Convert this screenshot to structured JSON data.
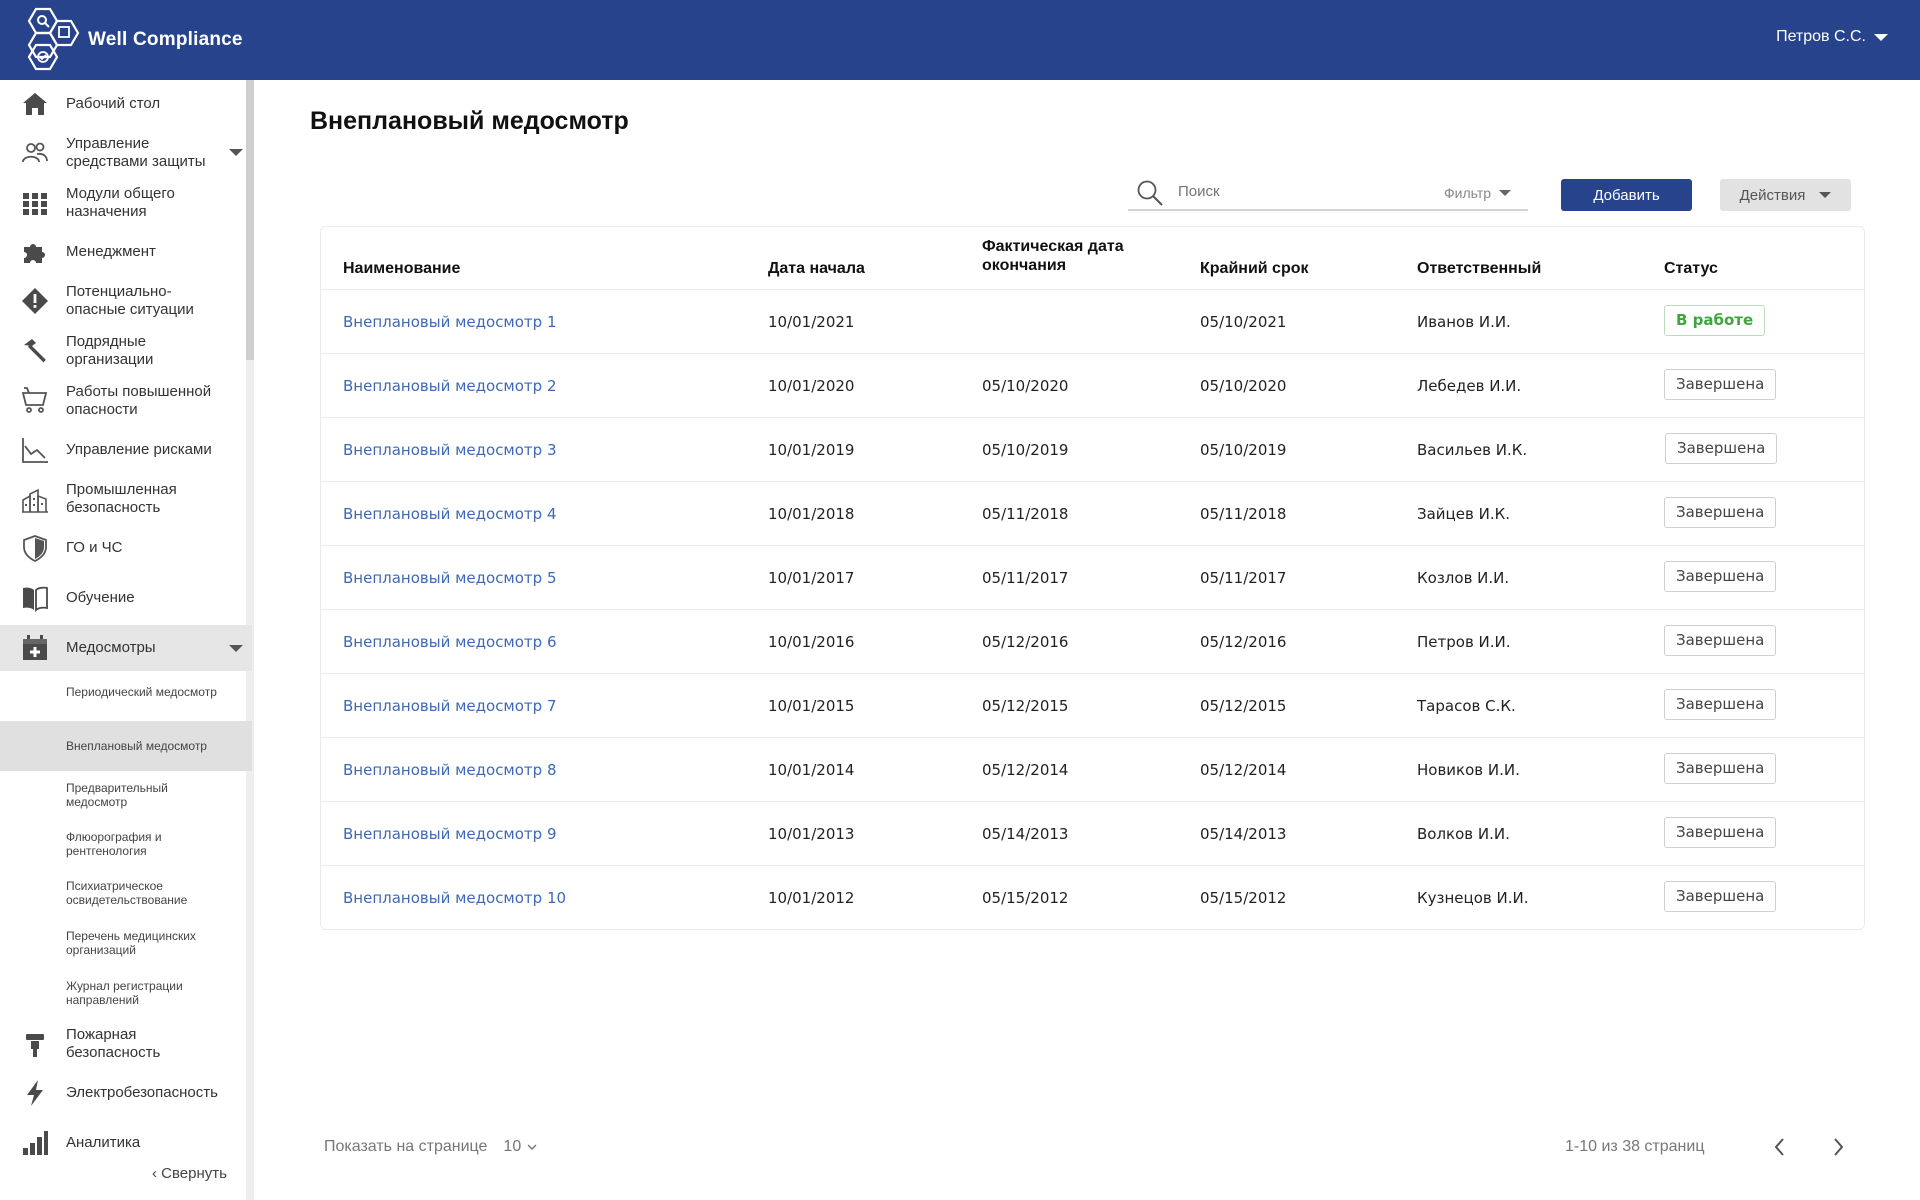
{
  "app": {
    "name": "Well Compliance",
    "user": "Петров С.С."
  },
  "colors": {
    "brand": "#27438c",
    "link": "#3e69b4",
    "status_active": "#3fa53f"
  },
  "sidebar": {
    "items": [
      {
        "label": "Рабочий стол",
        "icon": "home-icon"
      },
      {
        "label": "Управление средствами защиты",
        "icon": "users-icon"
      },
      {
        "label": "Модули общего назначения",
        "icon": "grid-icon"
      },
      {
        "label": "Менеджмент",
        "icon": "puzzle-icon"
      },
      {
        "label": "Потенциально-опасные ситуации",
        "icon": "warning-icon"
      },
      {
        "label": "Подрядные организации",
        "icon": "hammer-icon"
      },
      {
        "label": "Работы повышенной опасности",
        "icon": "cart-icon"
      },
      {
        "label": "Управление рисками",
        "icon": "chart-line-icon"
      },
      {
        "label": "Промышленная безопасность",
        "icon": "factory-icon"
      },
      {
        "label": "ГО и ЧС",
        "icon": "shield-icon"
      },
      {
        "label": "Обучение",
        "icon": "book-icon"
      },
      {
        "label": "Медосмотры",
        "icon": "medical-calendar-icon"
      },
      {
        "label": "Пожарная безопасность",
        "icon": "fire-extinguisher-icon"
      },
      {
        "label": "Электробезопасность",
        "icon": "lightning-icon"
      },
      {
        "label": "Аналитика",
        "icon": "bar-chart-icon"
      }
    ],
    "subitems": [
      {
        "label": "Периодический медосмотр"
      },
      {
        "label": "Внеплановый медосмотр"
      },
      {
        "label": "Предварительный медосмотр"
      },
      {
        "label": "Флюорография и рентгенология"
      },
      {
        "label": "Психиатрическое освидетельствование"
      },
      {
        "label": "Перечень медицинских организаций"
      },
      {
        "label": "Журнал регистрации направлений"
      }
    ],
    "collapse_label": "‹ Свернуть"
  },
  "page": {
    "title": "Внеплановый медосмотр"
  },
  "toolbar": {
    "search_placeholder": "Поиск",
    "filter_label": "Фильтр",
    "add_label": "Добавить",
    "actions_label": "Действия"
  },
  "table": {
    "columns": [
      "Наименование",
      "Дата начала",
      "Фактическая дата окончания",
      "Крайний срок",
      "Ответственный",
      "Статус"
    ],
    "rows": [
      {
        "name": "Внеплановый медосмотр 1",
        "start": "10/01/2021",
        "actual_end": "",
        "deadline": "05/10/2021",
        "responsible": "Иванов И.И.",
        "status": "В работе",
        "active": true
      },
      {
        "name": "Внеплановый  медосмотр 2",
        "start": "10/01/2020",
        "actual_end": "05/10/2020",
        "deadline": "05/10/2020",
        "responsible": "Лебедев И.И.",
        "status": "Завершена",
        "active": false
      },
      {
        "name": "Внеплановый  медосмотр 3",
        "start": "10/01/2019",
        "actual_end": "05/10/2019",
        "deadline": "05/10/2019",
        "responsible": "Васильев И.К.",
        "status": "Завершена",
        "active": false
      },
      {
        "name": "Внеплановый  медосмотр 4",
        "start": "10/01/2018",
        "actual_end": "05/11/2018",
        "deadline": "05/11/2018",
        "responsible": "Зайцев И.К.",
        "status": "Завершена",
        "active": false
      },
      {
        "name": "Внеплановый  медосмотр 5",
        "start": "10/01/2017",
        "actual_end": "05/11/2017",
        "deadline": "05/11/2017",
        "responsible": "Козлов И.И.",
        "status": "Завершена",
        "active": false
      },
      {
        "name": "Внеплановый  медосмотр 6",
        "start": "10/01/2016",
        "actual_end": "05/12/2016",
        "deadline": "05/12/2016",
        "responsible": "Петров И.И.",
        "status": "Завершена",
        "active": false
      },
      {
        "name": "Внеплановый  медосмотр 7",
        "start": "10/01/2015",
        "actual_end": "05/12/2015",
        "deadline": "05/12/2015",
        "responsible": "Тарасов С.К.",
        "status": "Завершена",
        "active": false
      },
      {
        "name": "Внеплановый  медосмотр 8",
        "start": "10/01/2014",
        "actual_end": "05/12/2014",
        "deadline": "05/12/2014",
        "responsible": "Новиков И.И.",
        "status": "Завершена",
        "active": false
      },
      {
        "name": "Внеплановый  медосмотр 9",
        "start": "10/01/2013",
        "actual_end": "05/14/2013",
        "deadline": "05/14/2013",
        "responsible": "Волков И.И.",
        "status": "Завершена",
        "active": false
      },
      {
        "name": "Внеплановый  медосмотр 10",
        "start": "10/01/2012",
        "actual_end": "05/15/2012",
        "deadline": "05/15/2012",
        "responsible": "Кузнецов И.И.",
        "status": "Завершена",
        "active": false
      }
    ]
  },
  "pagination": {
    "show_label": "Показать на странице",
    "page_size": "10",
    "info": "1-10 из 38 страниц"
  }
}
